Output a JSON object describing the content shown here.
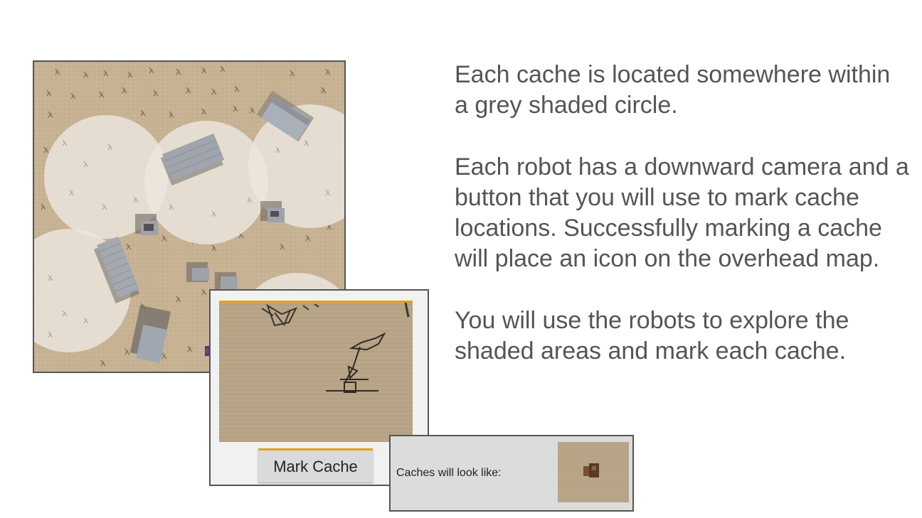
{
  "instructions": {
    "paragraph_1": "Each cache is located somewhere within a grey shaded circle.",
    "paragraph_2": "Each robot has a downward camera and a button that you will use to mark cache locations. Successfully marking a cache will place an icon on the overhead map.",
    "paragraph_3": "You will use the robots to explore the shaded areas and mark each cache."
  },
  "camera_panel": {
    "mark_button_label": "Mark Cache"
  },
  "legend": {
    "label": "Caches will look like:"
  },
  "colors": {
    "ground": "#c7b294",
    "shaded_circle": "#ece7de",
    "accent": "#e3a21a",
    "text": "#555555"
  }
}
